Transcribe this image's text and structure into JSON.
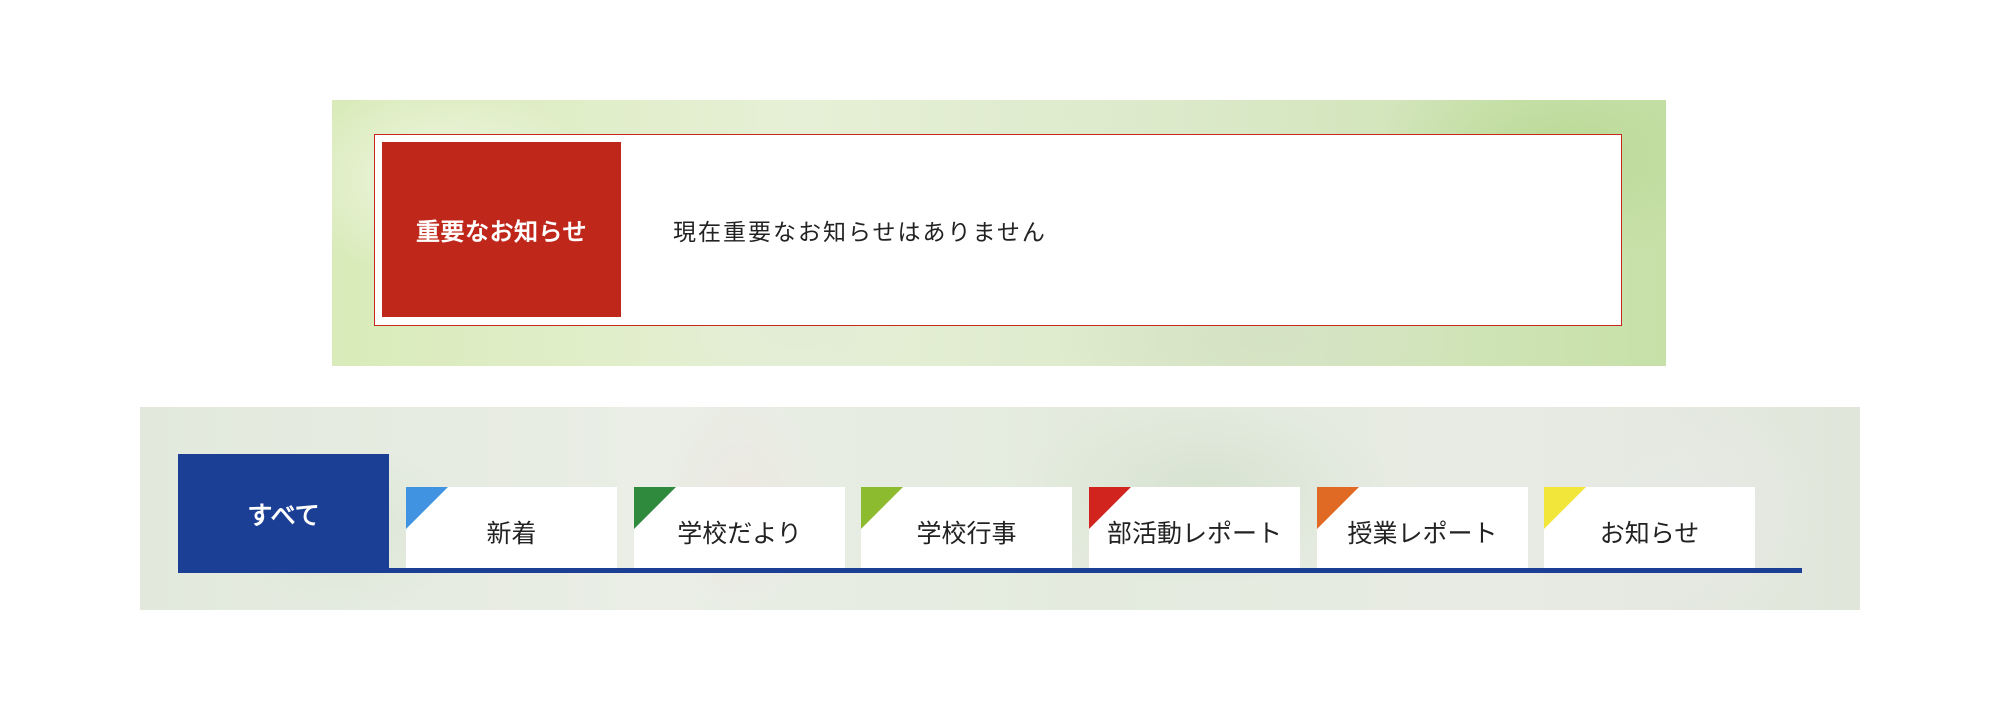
{
  "important_notice": {
    "label": "重要なお知らせ",
    "message": "現在重要なお知らせはありません"
  },
  "category_tabs": {
    "active": {
      "label": "すべて"
    },
    "items": [
      {
        "label": "新着",
        "flag_color": "#3f93e0"
      },
      {
        "label": "学校だより",
        "flag_color": "#2f8a3e"
      },
      {
        "label": "学校行事",
        "flag_color": "#8dbb2f"
      },
      {
        "label": "部活動レポート",
        "flag_color": "#d2241e"
      },
      {
        "label": "授業レポート",
        "flag_color": "#e06a24"
      },
      {
        "label": "お知らせ",
        "flag_color": "#f3e63a"
      }
    ]
  },
  "colors": {
    "notice_red": "#c0271b",
    "tab_blue": "#1b3f94"
  }
}
